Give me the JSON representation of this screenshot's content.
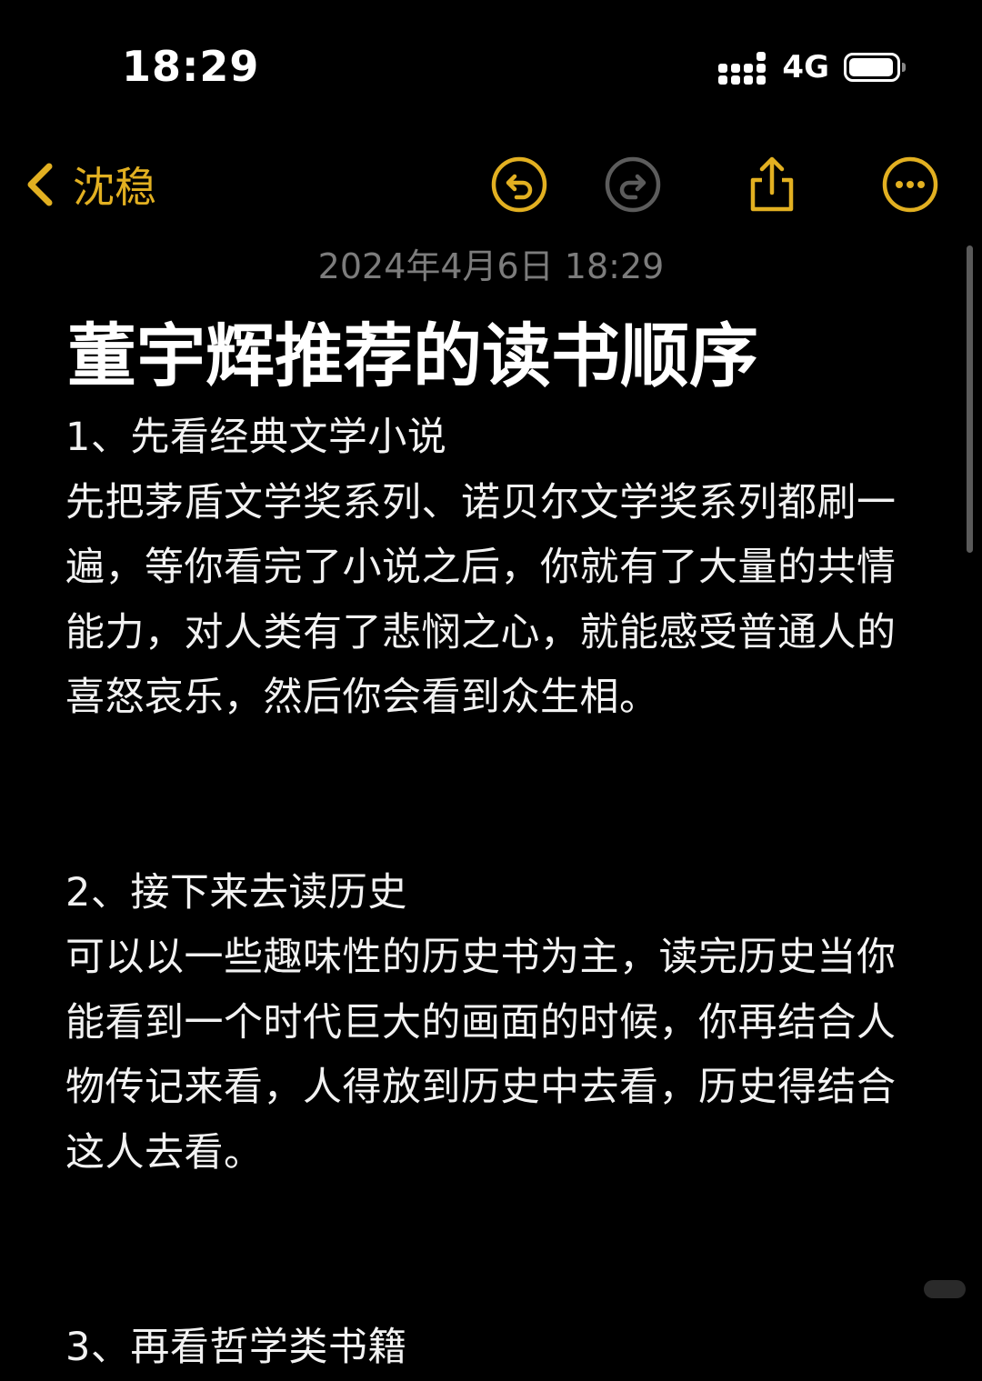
{
  "status_bar": {
    "time": "18:29",
    "network": "4G",
    "battery_level": 0.95,
    "icons": [
      "signal-icon",
      "battery-icon"
    ]
  },
  "nav": {
    "back_label": "沈稳",
    "accent_color": "#E2B021",
    "disabled_color": "#5c5c5c",
    "icons": [
      "chevron-left-icon",
      "undo-icon",
      "redo-icon",
      "share-icon",
      "more-icon"
    ]
  },
  "note": {
    "date": "2024年4月6日 18:29",
    "title": "董宇辉推荐的读书顺序",
    "sections": [
      {
        "heading": "1、先看经典文学小说",
        "text": "先把茅盾文学奖系列、诺贝尔文学奖系列都刷一遍，等你看完了小说之后，你就有了大量的共情能力，对人类有了悲悯之心，就能感受普通人的喜怒哀乐，然后你会看到众生相。"
      },
      {
        "heading": "2、接下来去读历史",
        "text": "可以以一些趣味性的历史书为主，读完历史当你能看到一个时代巨大的画面的时候，你再结合人物传记来看，人得放到历史中去看，历史得结合这人去看。"
      },
      {
        "heading": "3、再看哲学类书籍",
        "text": ""
      }
    ]
  }
}
